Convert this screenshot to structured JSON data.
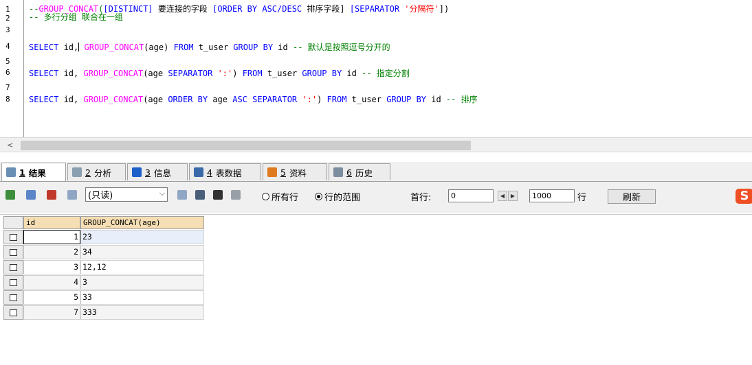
{
  "editor": {
    "lines": [
      {
        "num": "1",
        "segments": [
          {
            "cls": "cm",
            "t": "--"
          },
          {
            "cls": "fn",
            "t": "GROUP_CONCAT"
          },
          {
            "cls": "cm",
            "t": "("
          },
          {
            "cls": "kw",
            "t": "[DISTINCT]"
          },
          {
            "cls": "plain",
            "t": " 要连接的字段 "
          },
          {
            "cls": "kw",
            "t": "[ORDER BY ASC/DESC"
          },
          {
            "cls": "plain",
            "t": " 排序字段] "
          },
          {
            "cls": "kw",
            "t": "[SEPARATOR"
          },
          {
            "cls": "str",
            "t": " '分隔符'"
          },
          {
            "cls": "plain",
            "t": "])"
          }
        ]
      },
      {
        "num": "2",
        "segments": [
          {
            "cls": "cm",
            "t": "-- 多行分组 联合在一组"
          }
        ]
      },
      {
        "num": "3",
        "segments": []
      },
      {
        "num": "4",
        "segments": [
          {
            "cls": "kw",
            "t": "SELECT"
          },
          {
            "cls": "plain",
            "t": " id,"
          },
          {
            "cls": "caret",
            "t": ""
          },
          {
            "cls": "plain",
            "t": " "
          },
          {
            "cls": "fn",
            "t": "GROUP_CONCAT"
          },
          {
            "cls": "plain",
            "t": "(age) "
          },
          {
            "cls": "kw",
            "t": "FROM"
          },
          {
            "cls": "plain",
            "t": " t_user "
          },
          {
            "cls": "kw",
            "t": "GROUP BY"
          },
          {
            "cls": "plain",
            "t": " id "
          },
          {
            "cls": "cm",
            "t": "-- 默认是按照逗号分开的"
          }
        ]
      },
      {
        "num": "5",
        "segments": []
      },
      {
        "num": "6",
        "segments": [
          {
            "cls": "kw",
            "t": "SELECT"
          },
          {
            "cls": "plain",
            "t": " id, "
          },
          {
            "cls": "fn",
            "t": "GROUP_CONCAT"
          },
          {
            "cls": "plain",
            "t": "(age "
          },
          {
            "cls": "kw",
            "t": "SEPARATOR"
          },
          {
            "cls": "str",
            "t": " ':'"
          },
          {
            "cls": "plain",
            "t": ") "
          },
          {
            "cls": "kw",
            "t": "FROM"
          },
          {
            "cls": "plain",
            "t": " t_user "
          },
          {
            "cls": "kw",
            "t": "GROUP BY"
          },
          {
            "cls": "plain",
            "t": " id "
          },
          {
            "cls": "cm",
            "t": "-- 指定分割"
          }
        ]
      },
      {
        "num": "7",
        "segments": []
      },
      {
        "num": "8",
        "segments": [
          {
            "cls": "kw",
            "t": "SELECT"
          },
          {
            "cls": "plain",
            "t": " id, "
          },
          {
            "cls": "fn",
            "t": "GROUP_CONCAT"
          },
          {
            "cls": "plain",
            "t": "(age "
          },
          {
            "cls": "kw",
            "t": "ORDER BY"
          },
          {
            "cls": "plain",
            "t": " age "
          },
          {
            "cls": "kw",
            "t": "ASC SEPARATOR"
          },
          {
            "cls": "str",
            "t": " ':'"
          },
          {
            "cls": "plain",
            "t": ") "
          },
          {
            "cls": "kw",
            "t": "FROM"
          },
          {
            "cls": "plain",
            "t": " t_user "
          },
          {
            "cls": "kw",
            "t": "GROUP BY"
          },
          {
            "cls": "plain",
            "t": " id "
          },
          {
            "cls": "cm",
            "t": "-- 排序"
          }
        ]
      }
    ],
    "scroll_left": "<"
  },
  "tabs": [
    {
      "num": "1",
      "label": "结果",
      "icon": "result-table-icon",
      "color": "#6a8fb5",
      "active": true
    },
    {
      "num": "2",
      "label": "分析",
      "icon": "profiler-icon",
      "color": "#8aa0b0",
      "active": false
    },
    {
      "num": "3",
      "label": "信息",
      "icon": "info-icon",
      "color": "#1e5fc9",
      "active": false
    },
    {
      "num": "4",
      "label": "表数据",
      "icon": "table-data-icon",
      "color": "#3a6aa8",
      "active": false
    },
    {
      "num": "5",
      "label": "资料",
      "icon": "info-chart-icon",
      "color": "#e07a1f",
      "active": false
    },
    {
      "num": "6",
      "label": "历史",
      "icon": "calendar-history-icon",
      "color": "#7d8da0",
      "active": false
    }
  ],
  "toolbar": {
    "readonly_label": "(只读)",
    "radio_all": "所有行",
    "radio_range": "行的范围",
    "first_row_label": "首行:",
    "first_row_value": "0",
    "row_count_value": "1000",
    "rows_label": "行",
    "refresh_label": "刷新",
    "logo_letter": "S"
  },
  "grid": {
    "columns": [
      "id",
      "GROUP_CONCAT(age)"
    ],
    "rows": [
      {
        "id": "1",
        "val": "23"
      },
      {
        "id": "2",
        "val": "34"
      },
      {
        "id": "3",
        "val": "12,12"
      },
      {
        "id": "4",
        "val": "3"
      },
      {
        "id": "5",
        "val": "33"
      },
      {
        "id": "7",
        "val": "333"
      }
    ]
  }
}
